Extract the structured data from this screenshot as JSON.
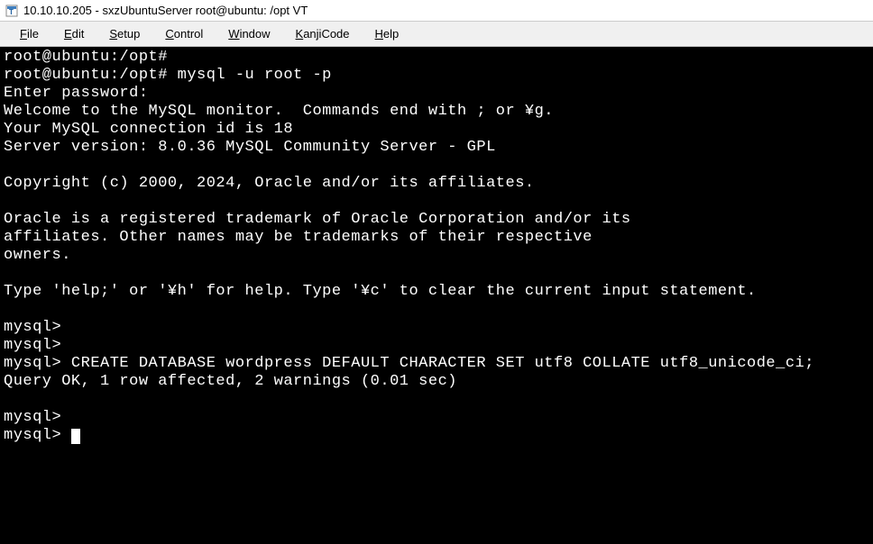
{
  "window": {
    "title": "10.10.10.205 - sxzUbuntuServer root@ubuntu: /opt VT"
  },
  "menu": {
    "file": "File",
    "edit": "Edit",
    "setup": "Setup",
    "control": "Control",
    "window": "Window",
    "kanji": "KanjiCode",
    "help": "Help"
  },
  "terminal": {
    "lines": [
      "root@ubuntu:/opt#",
      "root@ubuntu:/opt# mysql -u root -p",
      "Enter password:",
      "Welcome to the MySQL monitor.  Commands end with ; or ¥g.",
      "Your MySQL connection id is 18",
      "Server version: 8.0.36 MySQL Community Server - GPL",
      "",
      "Copyright (c) 2000, 2024, Oracle and/or its affiliates.",
      "",
      "Oracle is a registered trademark of Oracle Corporation and/or its",
      "affiliates. Other names may be trademarks of their respective",
      "owners.",
      "",
      "Type 'help;' or '¥h' for help. Type '¥c' to clear the current input statement.",
      "",
      "mysql>",
      "mysql>",
      "mysql> CREATE DATABASE wordpress DEFAULT CHARACTER SET utf8 COLLATE utf8_unicode_ci;",
      "Query OK, 1 row affected, 2 warnings (0.01 sec)",
      "",
      "mysql>",
      "mysql> "
    ]
  }
}
